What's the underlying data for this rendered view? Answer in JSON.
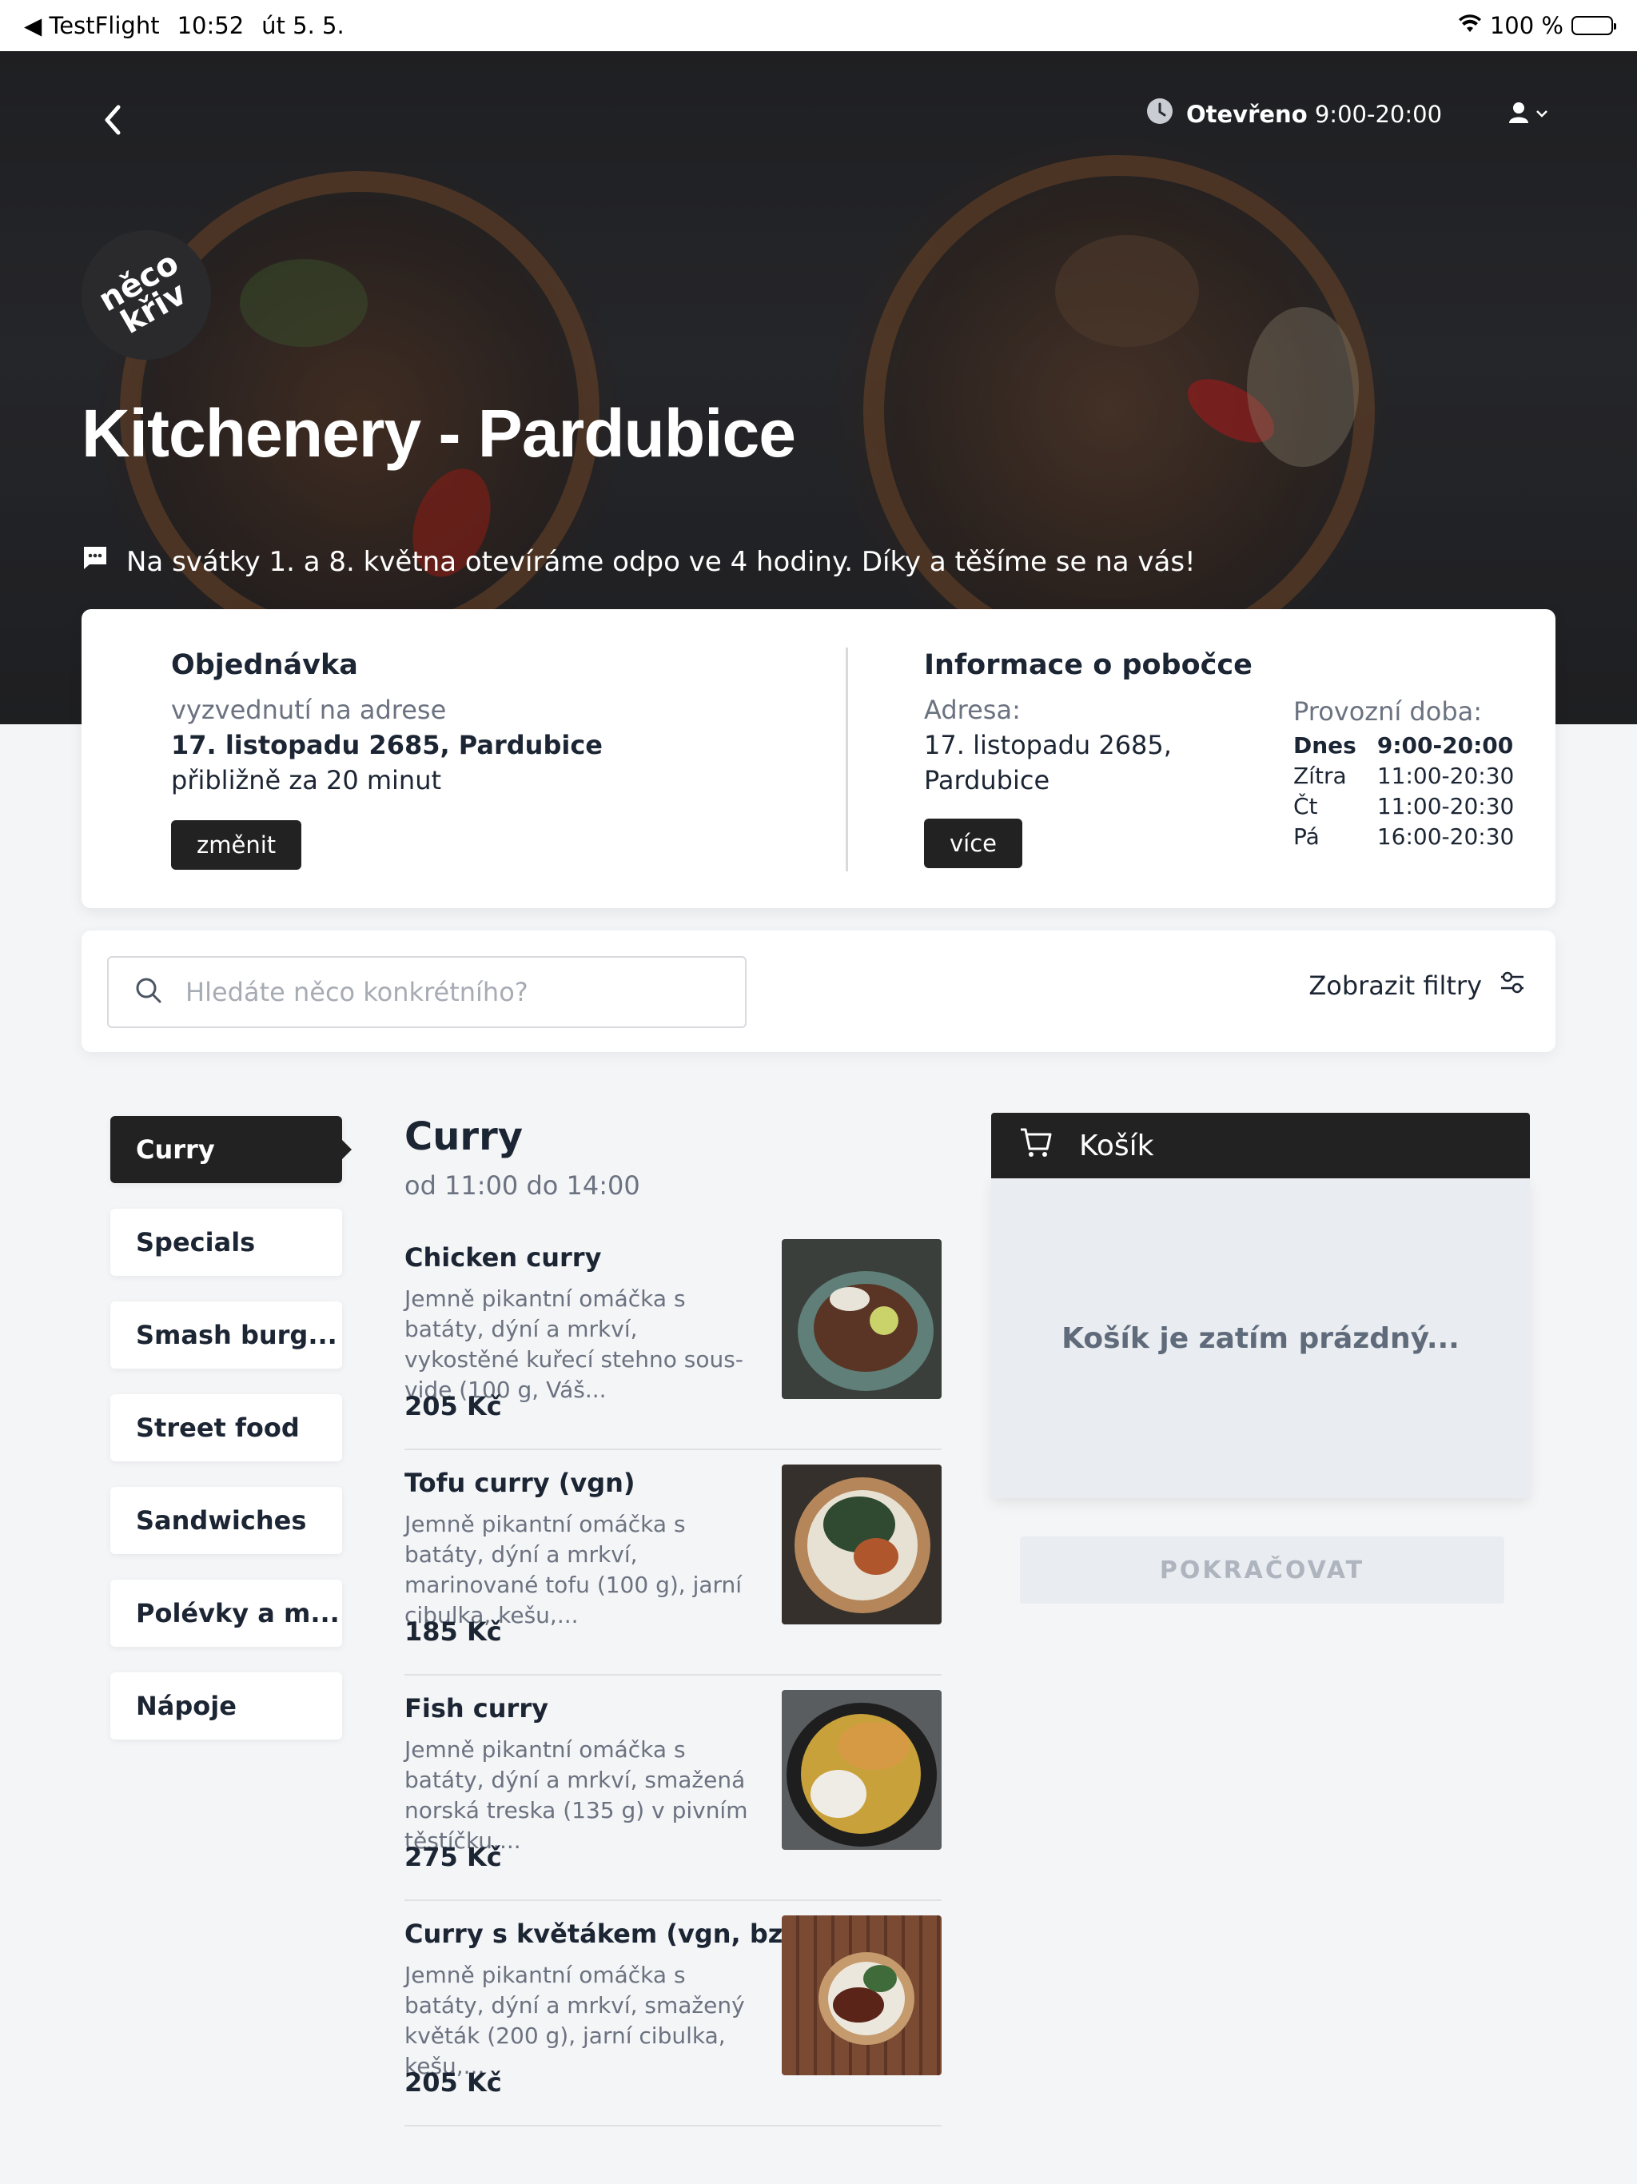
{
  "status_bar": {
    "back_app": "◀ TestFlight",
    "time": "10:52",
    "date": "út 5. 5.",
    "battery": "100 %"
  },
  "header": {
    "open_label": "Otevřeno",
    "open_hours": "9:00-20:00"
  },
  "restaurant": {
    "logo_text": "něco křiv",
    "name": "Kitchenery - Pardubice",
    "notice": "Na svátky 1. a 8. května otevíráme odpo ve 4 hodiny. Díky a těšíme se na vás!"
  },
  "order": {
    "heading": "Objednávka",
    "pickup_label": "vyzvednutí na adrese",
    "address": "17. listopadu 2685, Pardubice",
    "eta": "přibližně za 20 minut",
    "change_button": "změnit"
  },
  "branch": {
    "heading": "Informace o pobočce",
    "address_label": "Adresa:",
    "address_line1": "17. listopadu 2685,",
    "address_line2": "Pardubice",
    "more_button": "více",
    "hours_label": "Provozní doba:",
    "hours": [
      {
        "day": "Dnes",
        "time": "9:00-20:00"
      },
      {
        "day": "Zítra",
        "time": "11:00-20:30"
      },
      {
        "day": "Čt",
        "time": "11:00-20:30"
      },
      {
        "day": "Pá",
        "time": "16:00-20:30"
      }
    ]
  },
  "search": {
    "placeholder": "Hledáte něco konkrétního?",
    "filters_label": "Zobrazit filtry"
  },
  "categories": [
    {
      "label": "Curry"
    },
    {
      "label": "Specials"
    },
    {
      "label": "Smash burg..."
    },
    {
      "label": "Street food"
    },
    {
      "label": "Sandwiches"
    },
    {
      "label": "Polévky a m..."
    },
    {
      "label": "Nápoje"
    }
  ],
  "menu": {
    "title": "Curry",
    "time": "od 11:00 do 14:00",
    "items": [
      {
        "name": "Chicken curry",
        "desc": "Jemně pikantní omáčka s batáty, dýní a mrkví, vykostěné kuřecí stehno sous-vide (100 g, Váš...",
        "price": "205 Kč"
      },
      {
        "name": "Tofu curry (vgn)",
        "desc": "Jemně pikantní omáčka s batáty, dýní a mrkví, marinované tofu (100 g), jarní cibulka, kešu,...",
        "price": "185 Kč"
      },
      {
        "name": "Fish curry",
        "desc": "Jemně pikantní omáčka s batáty, dýní a mrkví, smažená norská treska (135 g) v pivním těstíčku,...",
        "price": "275 Kč"
      },
      {
        "name": "Curry s květákem (vgn, bzl)",
        "desc": "Jemně pikantní omáčka s batáty, dýní a mrkví, smažený květák (200 g), jarní cibulka, kešu,...",
        "price": "205 Kč"
      }
    ]
  },
  "cart": {
    "title": "Košík",
    "empty_text": "Košík je zatím prázdný...",
    "continue_button": "POKRAČOVAT"
  }
}
